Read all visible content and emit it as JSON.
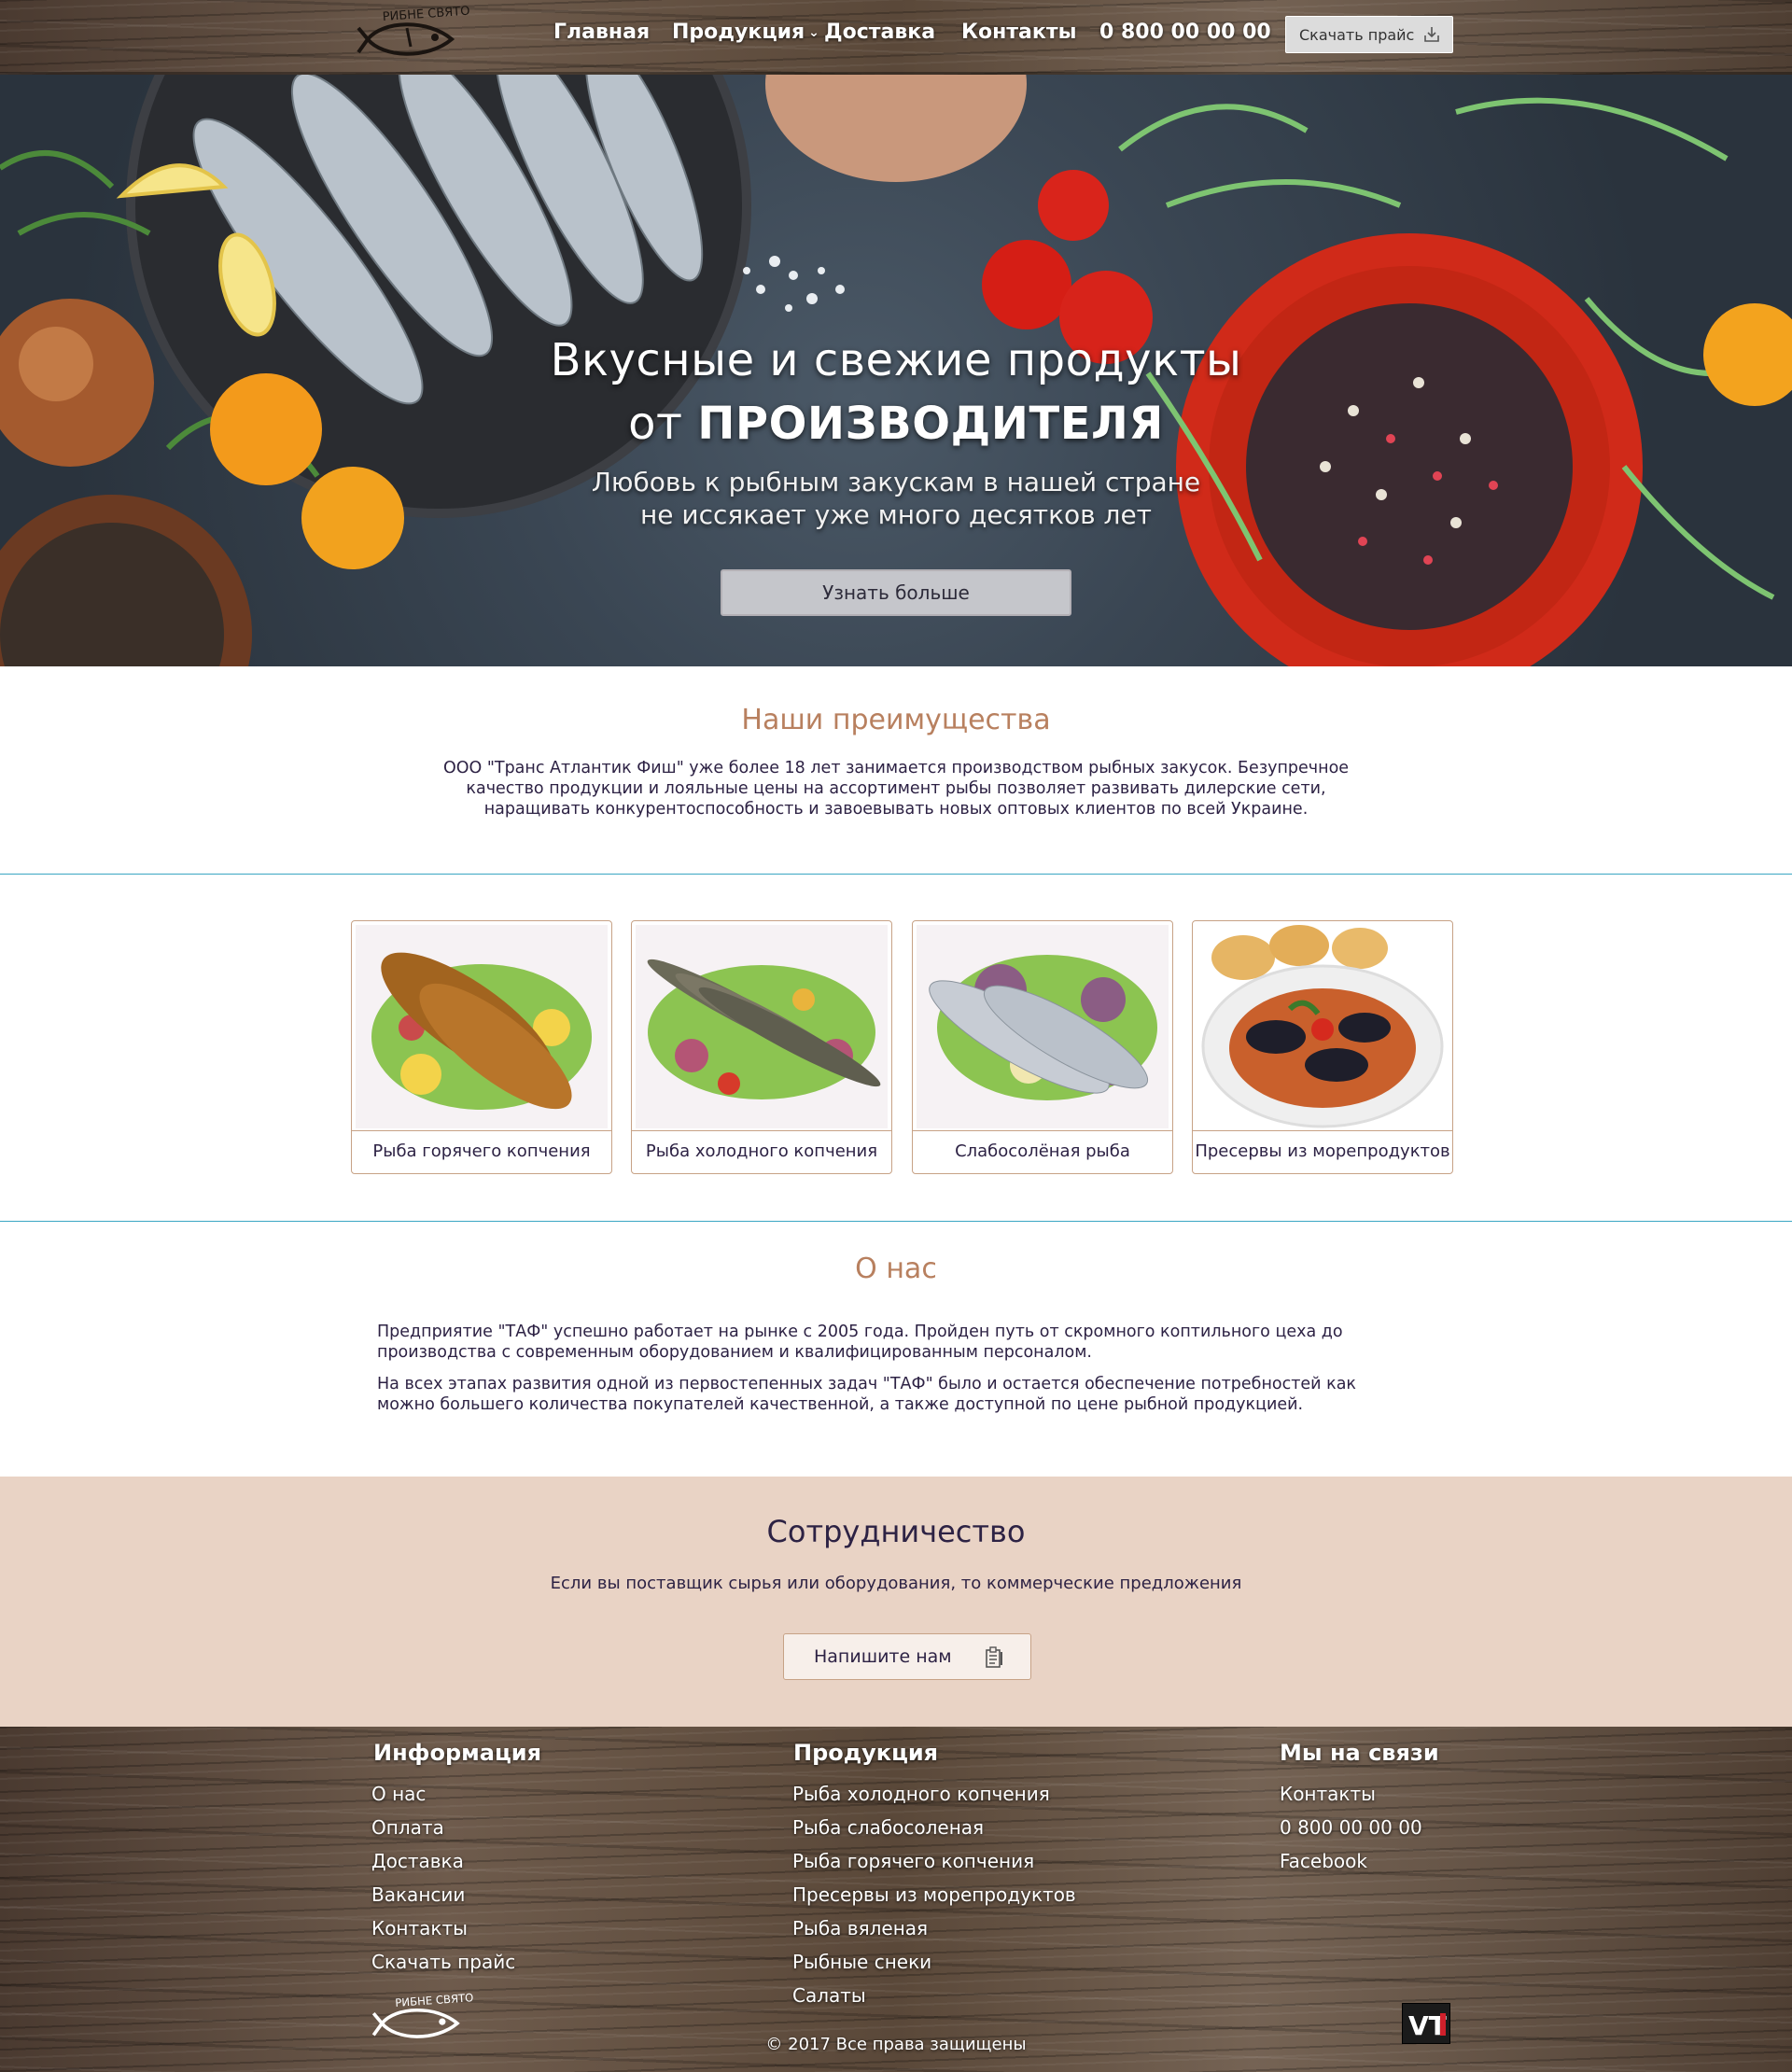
{
  "header": {
    "nav": [
      "Главная",
      "Продукция",
      "Доставка",
      "Контакты"
    ],
    "phone": "0 800 00 00 00",
    "price_button": "Скачать прайс",
    "logo_text": "РИБНЕ СВЯТО"
  },
  "hero": {
    "title_line1": "Вкусные и свежие продукты",
    "title_line2_prefix": "от",
    "title_line2_emph": "ПРОИЗВОДИТЕЛЯ",
    "subtitle_line1": "Любовь к рыбным закускам в нашей стране",
    "subtitle_line2": "не иссякает уже много десятков лет",
    "button": "Узнать больше"
  },
  "advantages": {
    "title": "Наши преимущества",
    "text": "ООО \"Транс Атлантик Фиш\" уже более 18 лет занимается производством рыбных закусок. Безупречное качество продукции и лояльные цены на ассортимент рыбы позволяет развивать дилерские сети, наращивать конкурентоспособность и завоевывать новых оптовых клиентов по всей Украине."
  },
  "products": [
    {
      "caption": "Рыба горячего копчения"
    },
    {
      "caption": "Рыба холодного копчения"
    },
    {
      "caption": "Слабосолёная рыба"
    },
    {
      "caption": "Пресервы из морепродуктов"
    }
  ],
  "about": {
    "title": "О нас",
    "p1": "Предприятие \"ТАФ\" успешно работает на рынке с 2005 года. Пройден путь от скромного коптильного цеха до производства с современным оборудованием и квалифицированным персоналом.",
    "p2": "На всех этапах развития одной из первостепенных задач \"ТАФ\" было и остается обеспечение потребностей как можно большего количества покупателей качественной, а также доступной по цене рыбной продукцией."
  },
  "cooperation": {
    "title": "Сотрудничество",
    "text": "Если вы поставщик сырья или оборудования, то коммерческие предложения",
    "button": "Напишите нам"
  },
  "footer": {
    "info_title": "Информация",
    "info_links": [
      "О нас",
      "Оплата",
      "Доставка",
      "Вакансии",
      "Контакты",
      "Скачать прайс"
    ],
    "products_title": "Продукция",
    "products_links": [
      "Рыба холодного копчения",
      "Рыба слабосоленая",
      "Рыба горячего копчения",
      "Пресервы из морепродуктов",
      "Рыба вяленая",
      "Рыбные снеки",
      "Салаты"
    ],
    "contact_title": "Мы на связи",
    "contact_links": [
      "Контакты",
      "0 800 00 00 00",
      "Facebook"
    ],
    "copyright": "© 2017 Все права защищены",
    "vt_logo": "VT"
  },
  "colors": {
    "accent": "#b8805f",
    "text": "#2d2244",
    "divider": "#3aa6c3",
    "coop_bg": "#e9d3c5"
  }
}
